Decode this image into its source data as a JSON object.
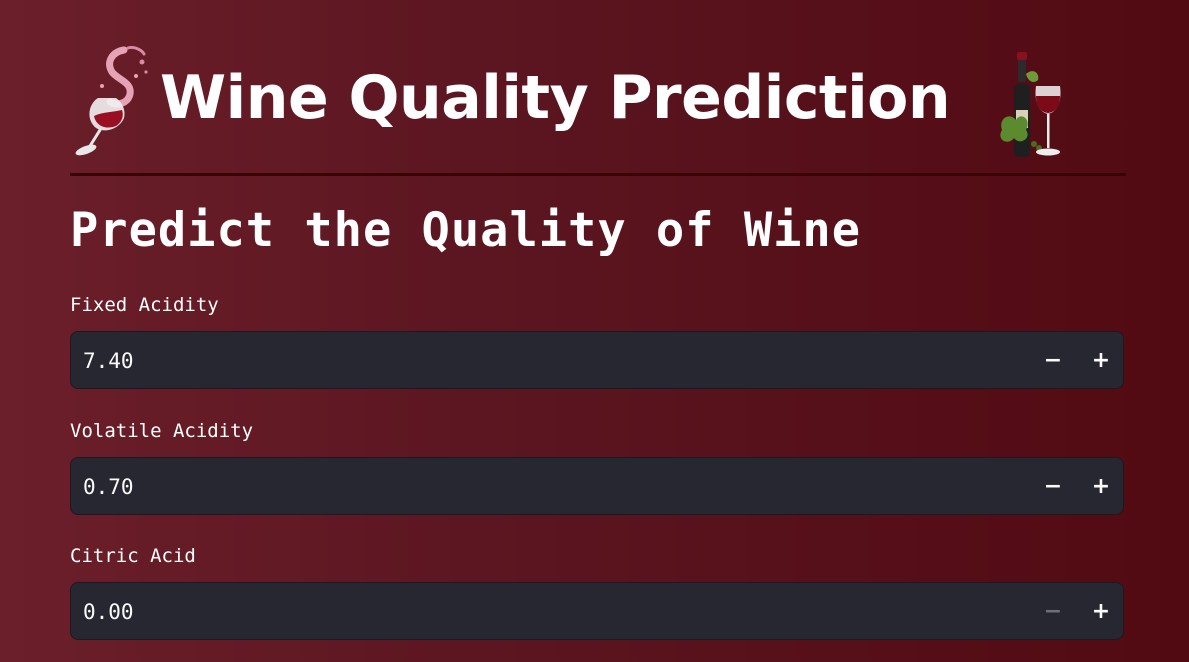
{
  "header": {
    "title": "Wine Quality Prediction",
    "left_image_icon": "wine-splash-glass-icon",
    "right_image_icon": "wine-bottle-glass-icon"
  },
  "subtitle": "Predict the Quality of Wine",
  "fields": [
    {
      "label": "Fixed Acidity",
      "value": "7.40",
      "minus_label": "−",
      "plus_label": "+",
      "minus_disabled": false
    },
    {
      "label": "Volatile Acidity",
      "value": "0.70",
      "minus_label": "−",
      "plus_label": "+",
      "minus_disabled": false
    },
    {
      "label": "Citric Acid",
      "value": "0.00",
      "minus_label": "−",
      "plus_label": "+",
      "minus_disabled": true
    }
  ],
  "colors": {
    "background_start": "#6b1f2a",
    "background_end": "#520a12",
    "input_background": "#262730",
    "divider": "#3a0306",
    "text": "#ffffff",
    "disabled_button": "#6e6f78"
  }
}
